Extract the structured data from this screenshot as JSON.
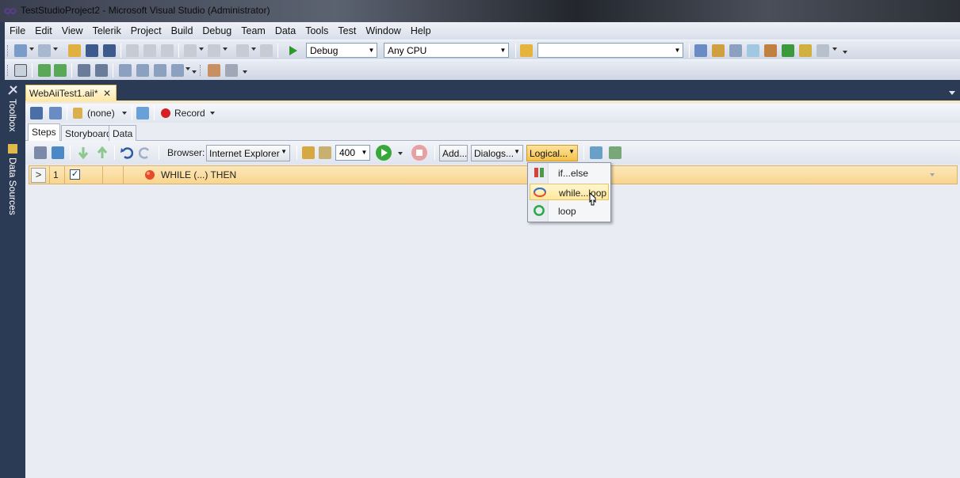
{
  "window": {
    "title": "TestStudioProject2 - Microsoft Visual Studio (Administrator)"
  },
  "menubar": [
    "File",
    "Edit",
    "View",
    "Telerik",
    "Project",
    "Build",
    "Debug",
    "Team",
    "Data",
    "Tools",
    "Test",
    "Window",
    "Help"
  ],
  "toolbar": {
    "config": "Debug",
    "platform": "Any CPU",
    "find_value": ""
  },
  "leftdock": {
    "toolbox": "Toolbox",
    "data_sources": "Data Sources"
  },
  "document": {
    "tab_title": "WebAiiTest1.aii*"
  },
  "test_toolbar": {
    "browser_selection": "(none)",
    "record": "Record"
  },
  "inner_tabs": [
    "Steps",
    "Storyboard",
    "Data"
  ],
  "steps_toolbar": {
    "browser_label": "Browser:",
    "browser_value": "Internet Explorer",
    "speed_value": "400",
    "add": "Add...",
    "dialogs": "Dialogs...",
    "logical": "Logical..."
  },
  "step": {
    "expander": ">",
    "number": "1",
    "checked": "✓",
    "text": "WHILE (...) THEN"
  },
  "logical_menu": [
    "if...else",
    "while...loop",
    "loop"
  ],
  "colors": {
    "accent": "#ffe8a6",
    "dock": "#2b3a55",
    "highlight": "#f9d58e"
  }
}
